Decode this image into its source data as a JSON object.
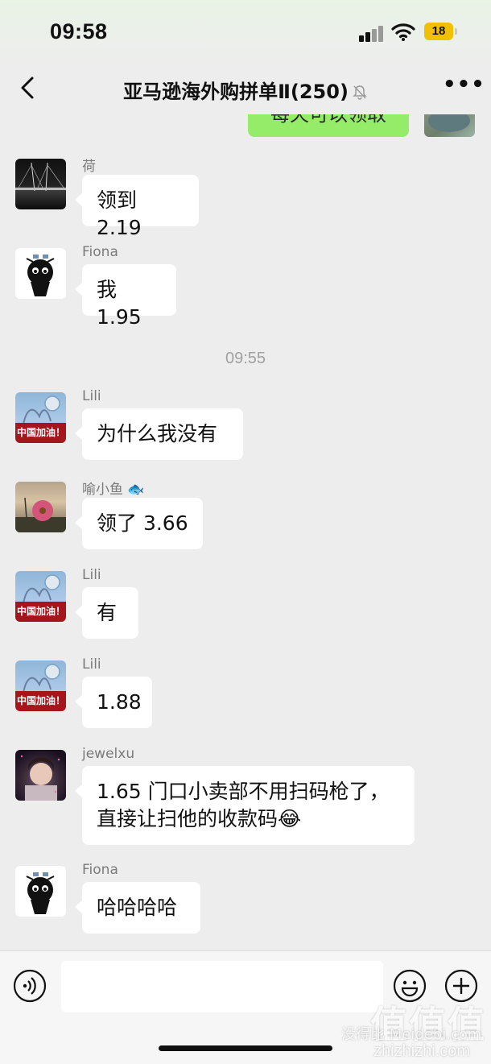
{
  "status_bar": {
    "time": "09:58",
    "battery": "18"
  },
  "navbar": {
    "title": "亚马逊海外购拼单Ⅱ(250)"
  },
  "partial_self_message": {
    "text": "每天可以领取"
  },
  "time_separator": "09:55",
  "messages": [
    {
      "sender": "荷",
      "text": "领到 2.19",
      "avatar": "bridge-night"
    },
    {
      "sender": "Fiona",
      "text": "我 1.95",
      "avatar": "black-cat"
    },
    {
      "sender": "Lili",
      "text": "为什么我没有",
      "avatar": "china-jiayou",
      "avatar_label": "中国加油！"
    },
    {
      "sender": "喻小鱼 🐟",
      "text": "领了 3.66",
      "avatar": "pink-flower"
    },
    {
      "sender": "Lili",
      "text": "有",
      "avatar": "china-jiayou",
      "avatar_label": "中国加油！"
    },
    {
      "sender": "Lili",
      "text": "1.88",
      "avatar": "china-jiayou",
      "avatar_label": "中国加油！"
    },
    {
      "sender": "jewelxu",
      "text_line1": "1.65 门口小卖部不用扫码枪了，",
      "text_line2": "直接让扫他的收款码😂",
      "avatar": "child-portrait"
    },
    {
      "sender": "Fiona",
      "text": "哈哈哈哈",
      "avatar": "black-cat"
    }
  ],
  "input_bar": {
    "placeholder": ""
  },
  "watermark": {
    "logo": "值值值",
    "text": "没得比 Meidebi.com",
    "url": "zhizhizhi.com"
  },
  "colors": {
    "background": "#ededed",
    "self_bubble": "#95ec69",
    "other_bubble": "#ffffff",
    "sender_name": "#7b7b7b"
  }
}
